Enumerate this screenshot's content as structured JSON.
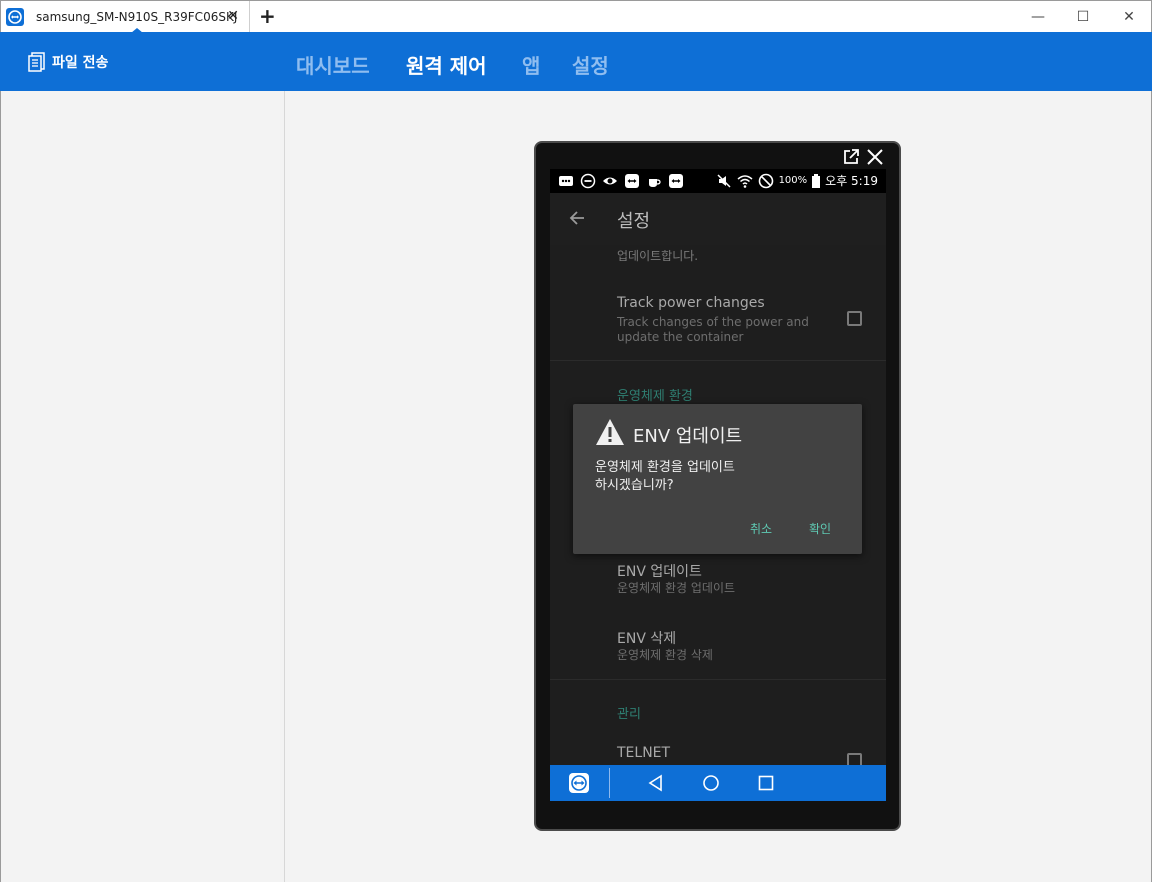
{
  "window": {
    "tab_title": "samsung_SM-N910S_R39FC06SKJ",
    "tab_close": "✕",
    "new_tab": "+",
    "controls": {
      "minimize": "—",
      "maximize": "☐",
      "close": "✕"
    }
  },
  "header": {
    "file_transfer": "파일 전송",
    "nav": [
      {
        "label": "대시보드",
        "active": false
      },
      {
        "label": "원격 제어",
        "active": true
      },
      {
        "label": "앱",
        "active": false
      },
      {
        "label": "설정",
        "active": false
      }
    ]
  },
  "device": {
    "statusbar": {
      "battery": "100%",
      "time": "오후 5:19"
    },
    "appbar": {
      "title": "설정"
    },
    "list": {
      "partial_text": "업데이트합니다.",
      "track_power": {
        "title": "Track power changes",
        "subtitle_line1": "Track changes of the power and",
        "subtitle_line2": "update the container"
      },
      "section_env": "운영체제 환경",
      "env_update": {
        "title": "ENV 업데이트",
        "subtitle": "운영체제 환경 업데이트"
      },
      "env_delete": {
        "title": "ENV 삭제",
        "subtitle": "운영체제 환경 삭제"
      },
      "section_manage": "관리",
      "telnet": {
        "title": "TELNET"
      }
    },
    "dialog": {
      "title": "ENV 업데이트",
      "message_line1": "운영체제 환경을 업데이트",
      "message_line2": "하시겠습니까?",
      "cancel": "취소",
      "confirm": "확인"
    }
  },
  "colors": {
    "brand_blue": "#0e6fd6",
    "accent_teal": "#5fc9b3",
    "dialog_bg": "#424242"
  }
}
